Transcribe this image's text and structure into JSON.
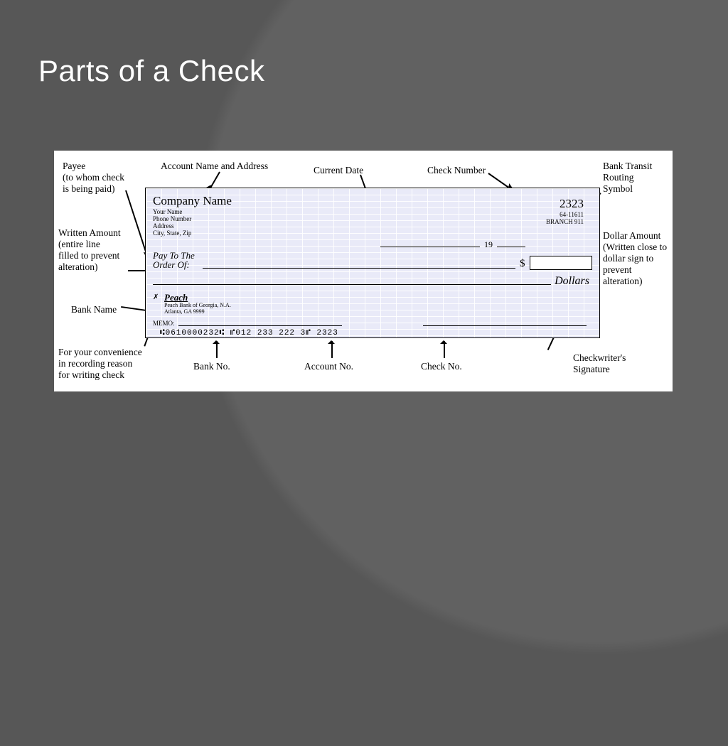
{
  "slide": {
    "title": "Parts of a Check"
  },
  "labels": {
    "payee": "Payee\n(to whom check\nis being paid)",
    "acct_name": "Account Name and Address",
    "current_date": "Current Date",
    "check_number": "Check Number",
    "transit": "Bank Transit\nRouting\nSymbol",
    "written_amount": "Written Amount\n(entire line\nfilled to prevent\nalteration)",
    "dollar_amount": "Dollar Amount\n(Written close to\ndollar sign to\nprevent\nalteration)",
    "bank_name": "Bank Name",
    "memo": "For your convenience\nin recording reason\nfor writing check",
    "bank_no": "Bank No.",
    "account_no": "Account No.",
    "check_no": "Check No.",
    "signature": "Checkwriter's\nSignature"
  },
  "check": {
    "company": "Company Name",
    "name_line": "Your Name",
    "phone_line": "Phone Number",
    "address_line": "Address",
    "city_line": "City, State, Zip",
    "number": "2323",
    "transit_code": "64-11611",
    "branch_code": "BRANCH 911",
    "date_year_prefix": "19",
    "pay_to": "Pay To The\nOrder Of:",
    "dollar_sign": "$",
    "dollars_word": "Dollars",
    "bank_logo_glyph": "✗",
    "bank_name": "Peach",
    "bank_line2": "Peach Bank of Georgia, N.A.",
    "bank_line3": "Atlanta, GA  9999",
    "memo_label": "MEMO:",
    "micr": "⑆0610000232⑆  ⑈012 233 222  3⑈     2323"
  }
}
